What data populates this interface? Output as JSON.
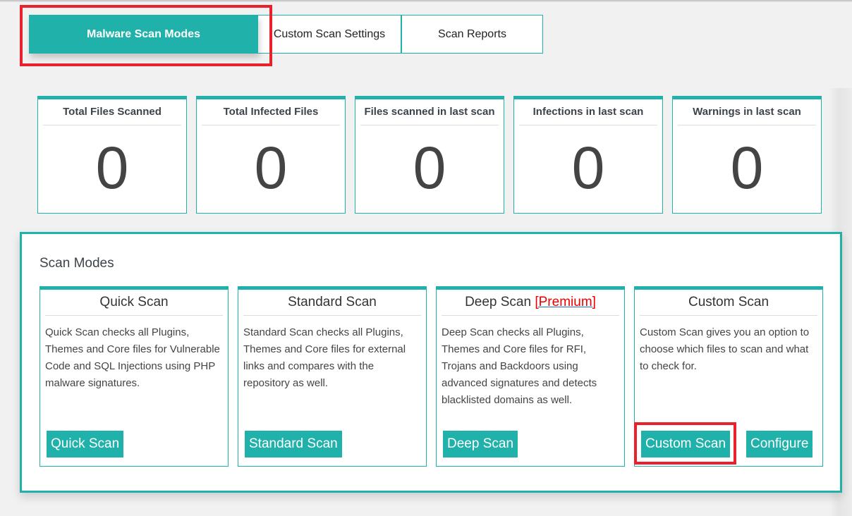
{
  "tabs": [
    {
      "label": "Malware Scan Modes",
      "active": true
    },
    {
      "label": "Custom Scan Settings",
      "active": false
    },
    {
      "label": "Scan Reports",
      "active": false
    }
  ],
  "stats": [
    {
      "title": "Total Files Scanned",
      "value": "0"
    },
    {
      "title": "Total Infected Files",
      "value": "0"
    },
    {
      "title": "Files scanned in last scan",
      "value": "0"
    },
    {
      "title": "Infections in last scan",
      "value": "0"
    },
    {
      "title": "Warnings in last scan",
      "value": "0"
    }
  ],
  "scan_modes": {
    "title": "Scan Modes",
    "modes": [
      {
        "title": "Quick Scan",
        "description": "Quick Scan checks all Plugins, Themes and Core files for Vulnerable Code and SQL Injections using PHP malware signatures.",
        "buttons": [
          "Quick Scan"
        ]
      },
      {
        "title": "Standard Scan",
        "description": "Standard Scan checks all Plugins, Themes and Core files for external links and compares with the repository as well.",
        "buttons": [
          "Standard Scan"
        ]
      },
      {
        "title": "Deep Scan",
        "badge": "[Premium]",
        "description": "Deep Scan checks all Plugins, Themes and Core files for RFI, Trojans and Backdoors using advanced signatures and detects blacklisted domains as well.",
        "buttons": [
          "Deep Scan"
        ]
      },
      {
        "title": "Custom Scan",
        "description": "Custom Scan gives you an option to choose which files to scan and what to check for.",
        "buttons": [
          "Custom Scan",
          "Configure"
        ]
      }
    ]
  },
  "colors": {
    "accent": "#20b2aa",
    "highlight": "#e8212b",
    "premium": "#ee0000"
  }
}
